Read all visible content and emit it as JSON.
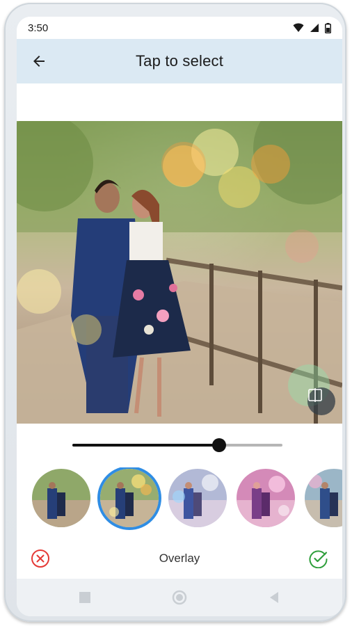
{
  "status_bar": {
    "time": "3:50",
    "icons": [
      "wifi-icon",
      "signal-icon",
      "battery-icon"
    ]
  },
  "app_bar": {
    "title": "Tap to select",
    "back_icon": "arrow-left-icon"
  },
  "editor": {
    "photo_description_icon": "compare-icon",
    "slider_level": 0.7
  },
  "overlays": {
    "selected_index": 1,
    "count_visible": 5
  },
  "bottom_bar": {
    "label": "Overlay",
    "cancel_icon": "close-circle-icon",
    "apply_icon": "check-circle-icon",
    "cancel_color": "#e53935",
    "apply_color": "#2e9e3b"
  },
  "nav_bar": {
    "icons": [
      "recent-apps-icon",
      "home-icon",
      "back-icon"
    ]
  },
  "colors": {
    "appbar_bg": "#dbe9f3",
    "selection_ring": "#2f8de4"
  }
}
